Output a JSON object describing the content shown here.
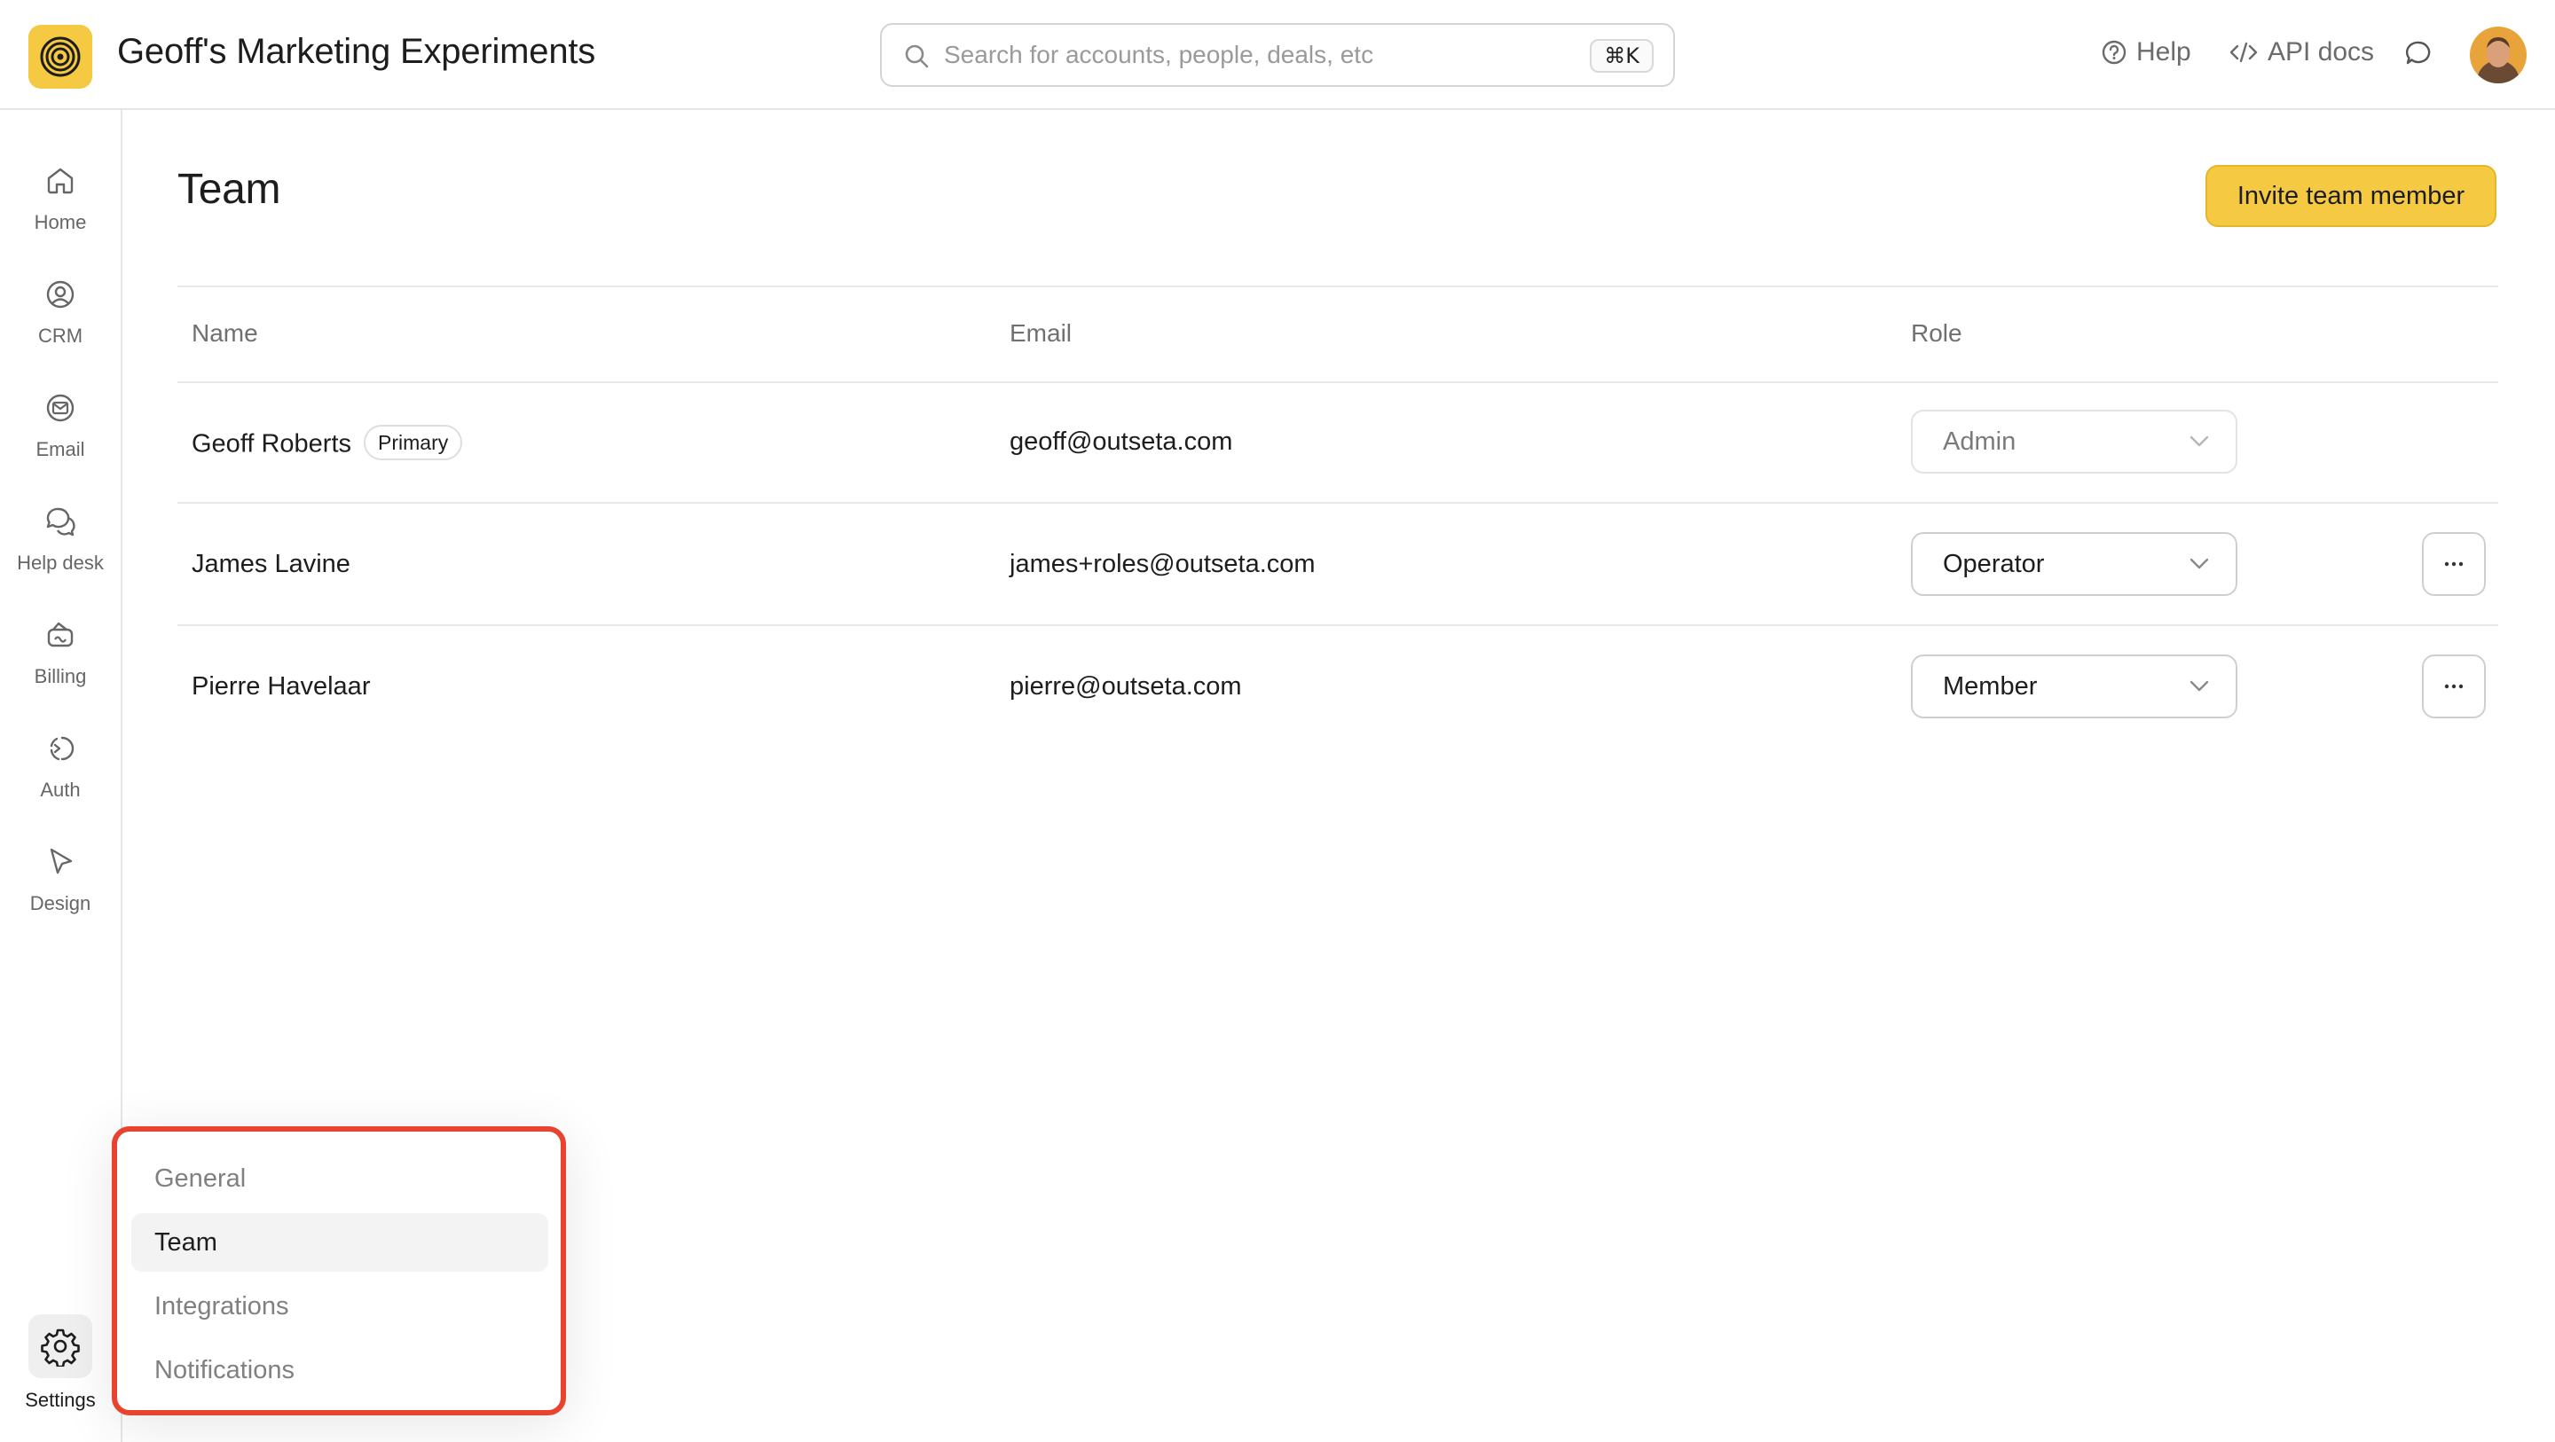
{
  "header": {
    "app_title": "Geoff's Marketing Experiments",
    "search_placeholder": "Search for accounts, people, deals, etc",
    "search_shortcut": "⌘K",
    "help_label": "Help",
    "api_docs_label": "API docs"
  },
  "sidebar": {
    "items": [
      {
        "label": "Home",
        "icon": "home-icon"
      },
      {
        "label": "CRM",
        "icon": "crm-icon"
      },
      {
        "label": "Email",
        "icon": "email-icon"
      },
      {
        "label": "Help desk",
        "icon": "help-desk-icon"
      },
      {
        "label": "Billing",
        "icon": "billing-icon"
      },
      {
        "label": "Auth",
        "icon": "auth-icon"
      },
      {
        "label": "Design",
        "icon": "design-icon"
      }
    ],
    "settings_label": "Settings"
  },
  "main": {
    "title": "Team",
    "invite_button": "Invite team member",
    "columns": [
      "Name",
      "Email",
      "Role"
    ],
    "rows": [
      {
        "name": "Geoff Roberts",
        "badge": "Primary",
        "email": "geoff@outseta.com",
        "role": "Admin"
      },
      {
        "name": "James Lavine",
        "email": "james+roles@outseta.com",
        "role": "Operator"
      },
      {
        "name": "Pierre Havelaar",
        "email": "pierre@outseta.com",
        "role": "Member"
      }
    ]
  },
  "settings_menu": {
    "items": [
      "General",
      "Team",
      "Integrations",
      "Notifications"
    ],
    "active": "Team"
  },
  "colors": {
    "accent": "#f6c943",
    "highlight_border": "#e8432e"
  }
}
